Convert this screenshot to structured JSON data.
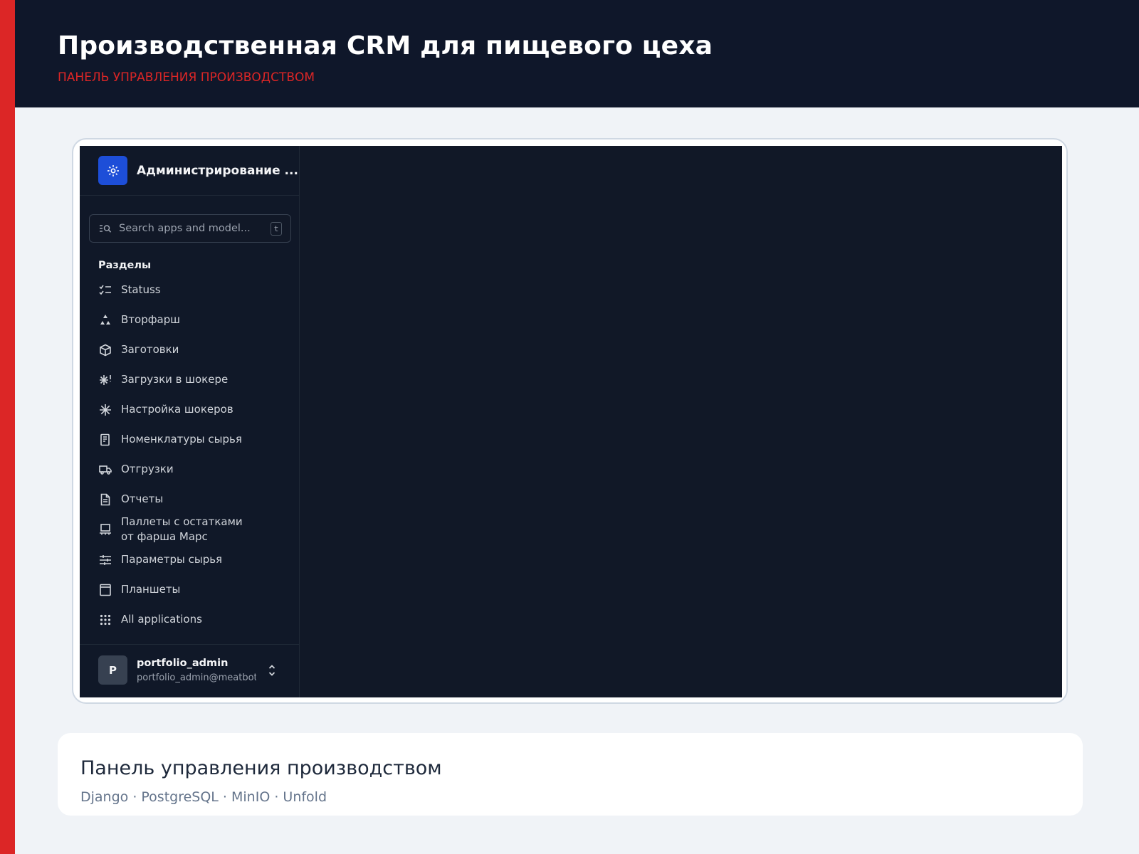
{
  "header": {
    "title": "Производственная CRM для пищевого цеха",
    "subtitle": "ПАНЕЛЬ УПРАВЛЕНИЯ ПРОИЗВОДСТВОМ"
  },
  "admin": {
    "brand_title": "Администрирование ...",
    "search": {
      "placeholder": "Search apps and model...",
      "shortcut": "t"
    },
    "section_label": "Разделы",
    "nav": [
      {
        "label": "Statuss",
        "icon": "checklist-icon"
      },
      {
        "label": "Вторфарш",
        "icon": "recycle-icon"
      },
      {
        "label": "Заготовки",
        "icon": "box-icon"
      },
      {
        "label": "Загрузки в шокере",
        "icon": "snowflake-alert-icon"
      },
      {
        "label": "Настройка шокеров",
        "icon": "snowflake-icon"
      },
      {
        "label": "Номенклатуры сырья",
        "icon": "receipt-icon"
      },
      {
        "label": "Отгрузки",
        "icon": "truck-icon"
      },
      {
        "label": "Отчеты",
        "icon": "document-icon"
      },
      {
        "label": "Паллеты с остатками от фарша Марс",
        "icon": "pallet-icon"
      },
      {
        "label": "Параметры сырья",
        "icon": "sliders-icon"
      },
      {
        "label": "Планшеты",
        "icon": "tablet-icon"
      }
    ],
    "all_apps_label": "All applications",
    "user": {
      "initial": "P",
      "name": "portfolio_admin",
      "email": "portfolio_admin@meatbot..."
    }
  },
  "card": {
    "title": "Панель управления производством",
    "stack": "Django · PostgreSQL · MinIO · Unfold"
  },
  "colors": {
    "accent": "#dc2626",
    "header_bg": "#0f172a",
    "admin_bg": "#111827",
    "brand_icon": "#1d4ed8"
  }
}
